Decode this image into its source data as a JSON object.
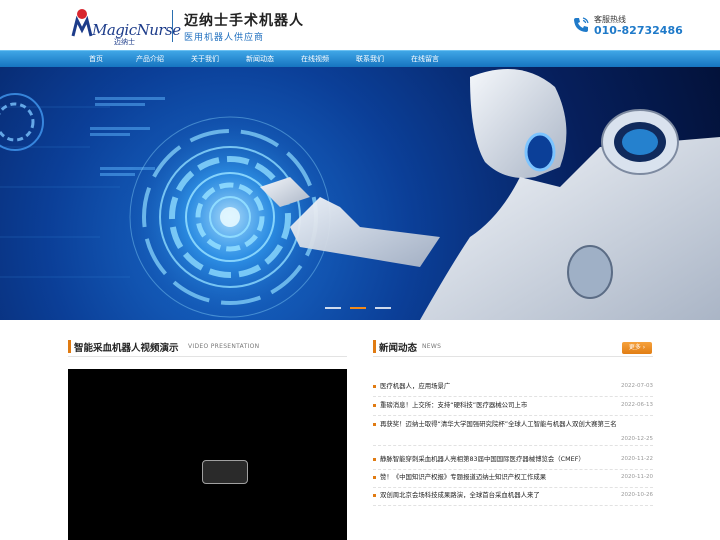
{
  "header": {
    "logo_text": "MagicNurse",
    "logo_sub": "迈纳士",
    "brand_title": "迈纳士手术机器人",
    "brand_sub": "医用机器人供应商",
    "hotline_label": "客服热线",
    "hotline_number": "010-82732486"
  },
  "nav": {
    "items": [
      "首页",
      "产品介绍",
      "关于我们",
      "新闻动态",
      "在线视频",
      "联系我们",
      "在线留言"
    ]
  },
  "video_section": {
    "title": "智能采血机器人视频演示",
    "subtitle": "VIDEO PRESENTATION"
  },
  "news_section": {
    "title": "新闻动态",
    "subtitle": "NEWS",
    "more_label": "更多",
    "items": [
      {
        "title": "医疗机器人，应用场景广",
        "date": "2022-07-03"
      },
      {
        "title": "重磅消息！上交所：支持“硬科技”医疗器械公司上市",
        "date": "2022-06-13"
      },
      {
        "title": "再获奖！迈纳士取得“清华大学国强研究院杯”全球人工智能与机器人双创大赛第三名",
        "date": "2020-12-25"
      },
      {
        "title": "静脉智能穿刺采血机器人亮相第83届中国国际医疗器械博览会（CMEF）",
        "date": "2020-11-22"
      },
      {
        "title": "赞！《中国知识产权报》专题报道迈纳士知识产权工作成果",
        "date": "2020-11-20"
      },
      {
        "title": "双创周北京会场科技成果路演，全球首台采血机器人来了",
        "date": "2020-10-26"
      }
    ]
  },
  "colors": {
    "brand_blue": "#1f7ac9",
    "nav_blue": "#1674c0",
    "accent_orange": "#e07b12"
  }
}
